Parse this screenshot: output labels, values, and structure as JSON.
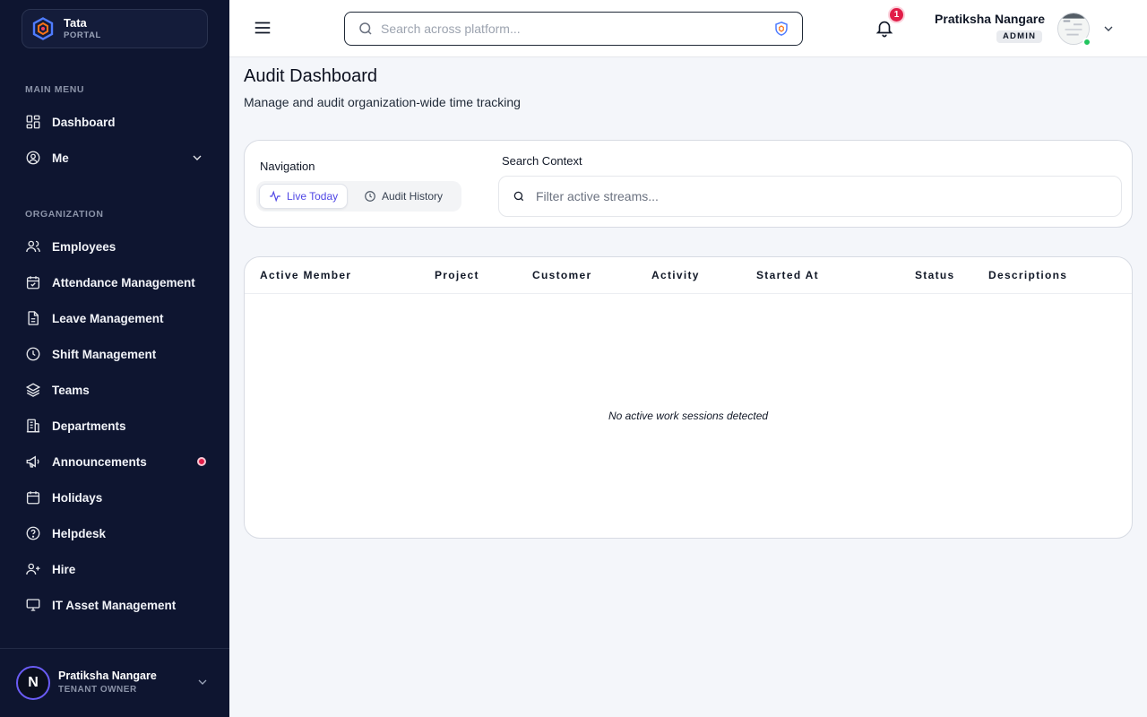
{
  "brand": {
    "name": "Tata",
    "sub": "PORTAL"
  },
  "sidebar": {
    "main_label": "MAIN MENU",
    "main_items": [
      {
        "label": "Dashboard",
        "icon": "dashboard-icon"
      },
      {
        "label": "Me",
        "icon": "user-circle-icon",
        "expandable": true
      }
    ],
    "org_label": "ORGANIZATION",
    "org_items": [
      {
        "label": "Employees",
        "icon": "users-icon"
      },
      {
        "label": "Attendance Management",
        "icon": "calendar-check-icon"
      },
      {
        "label": "Leave Management",
        "icon": "document-icon"
      },
      {
        "label": "Shift Management",
        "icon": "clock-icon"
      },
      {
        "label": "Teams",
        "icon": "layers-icon"
      },
      {
        "label": "Departments",
        "icon": "building-icon"
      },
      {
        "label": "Announcements",
        "icon": "megaphone-icon",
        "has_notification": true
      },
      {
        "label": "Holidays",
        "icon": "calendar-icon"
      },
      {
        "label": "Helpdesk",
        "icon": "help-circle-icon"
      },
      {
        "label": "Hire",
        "icon": "user-plus-icon"
      },
      {
        "label": "IT Asset Management",
        "icon": "monitor-icon"
      }
    ],
    "footer": {
      "avatar_letter": "N",
      "name": "Pratiksha Nangare",
      "role": "TENANT OWNER"
    }
  },
  "topbar": {
    "search_placeholder": "Search across platform...",
    "notification_count": "1",
    "user_name": "Pratiksha Nangare",
    "user_role": "ADMIN"
  },
  "page": {
    "title": "Audit Dashboard",
    "subtitle": "Manage and audit organization-wide time tracking"
  },
  "filters": {
    "navigation_label": "Navigation",
    "tabs": [
      {
        "label": "Live Today",
        "active": true,
        "icon": "activity-icon"
      },
      {
        "label": "Audit History",
        "active": false,
        "icon": "history-icon"
      }
    ],
    "context_label": "Search Context",
    "context_placeholder": "Filter active streams..."
  },
  "table": {
    "columns": [
      "Active Member",
      "Project",
      "Customer",
      "Activity",
      "Started At",
      "Status",
      "Descriptions"
    ],
    "empty_message": "No active work sessions detected"
  },
  "colors": {
    "sidebar_bg": "#0e1530",
    "accent": "#4f46e5",
    "badge": "#e11d48",
    "online": "#22c55e"
  }
}
